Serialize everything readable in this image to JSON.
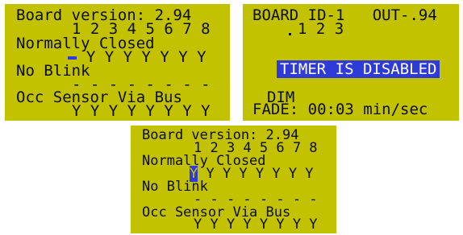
{
  "panel1": {
    "line_version": "Board version: 2.94",
    "line_channels": "1 2 3 4 5 6 7 8",
    "line_mode": "Normally Closed",
    "line_mode_values_rest": " Y Y Y Y Y Y Y",
    "line_blink": "No Blink",
    "line_dashes": "- - - - - - - -",
    "line_sensor": "Occ Sensor Via Bus",
    "line_sensor_values": "Y Y Y Y Y Y Y Y"
  },
  "panel2": {
    "line_header": "BOARD ID-1   OUT-.94",
    "line_channels": "1 2 3",
    "banner": "TIMER IS DISABLED",
    "line_dim": "DIM",
    "line_fade": "FADE: 00:03 min/sec"
  },
  "panel3": {
    "line_version": "Board version: 2.94",
    "line_channels": "1 2 3 4 5 6 7 8",
    "line_mode": "Normally Closed",
    "selected_value": "Y",
    "line_mode_values_rest": " Y Y Y Y Y Y Y",
    "line_blink": "No Blink",
    "line_dashes": "- - - - - - - -",
    "line_sensor": "Occ Sensor Via Bus",
    "line_sensor_values": "Y Y Y Y Y Y Y Y"
  },
  "colors": {
    "lcd_background": "#c3c200",
    "text": "#0c0c0c",
    "highlight": "#2f3bd6"
  }
}
